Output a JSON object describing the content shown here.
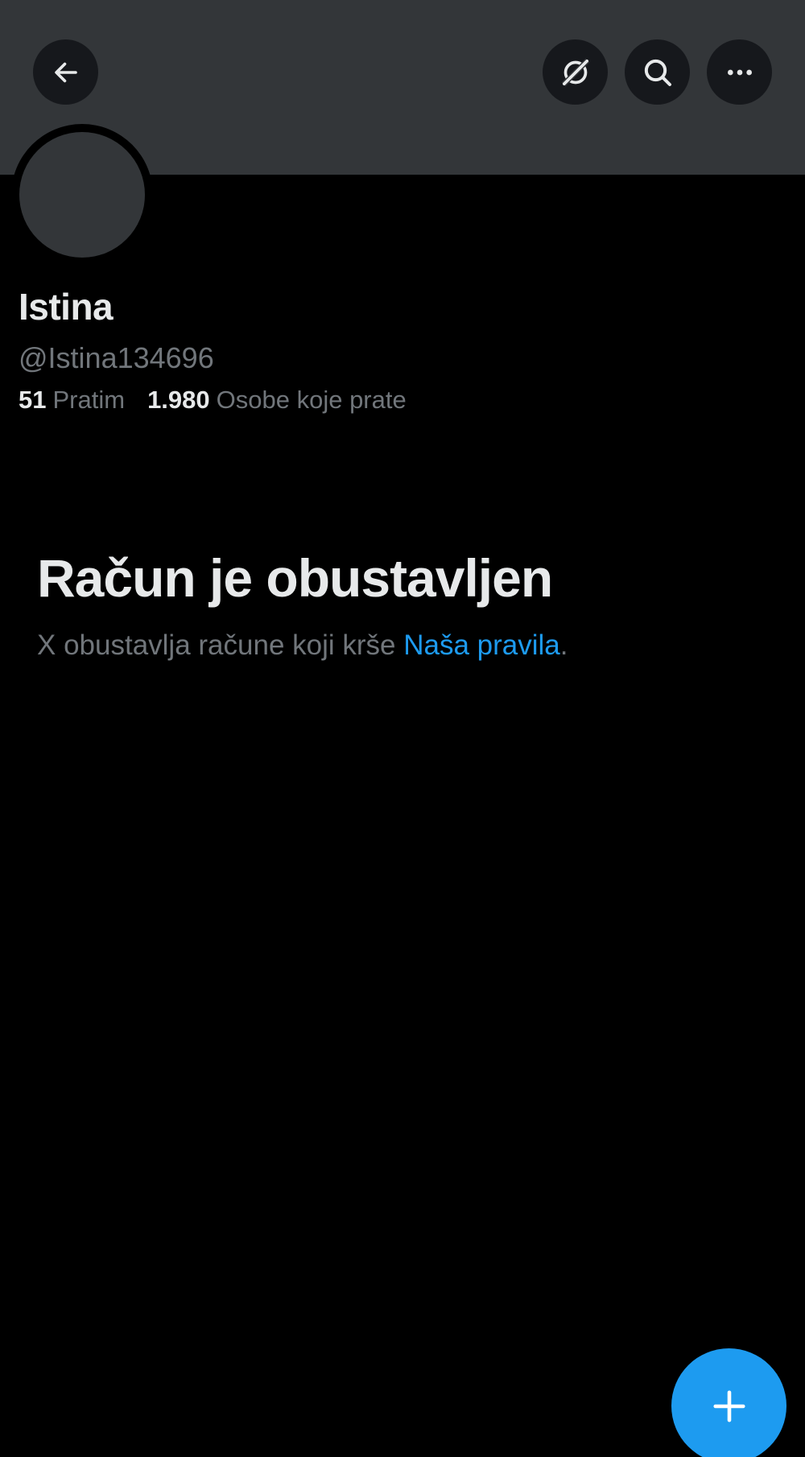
{
  "profile": {
    "display_name": "Istina",
    "handle": "@Istina134696",
    "following_count": "51",
    "following_label": "Pratim",
    "followers_count": "1.980",
    "followers_label": "Osobe koje prate"
  },
  "suspension": {
    "title": "Račun je obustavljen",
    "message": "X obustavlja račune koji krše",
    "link_text": "Naša pravila",
    "trailing": "."
  },
  "icons": {
    "back": "arrow-left-icon",
    "grok": "grok-icon",
    "search": "search-icon",
    "more": "more-dots-icon",
    "compose": "plus-icon"
  },
  "colors": {
    "background": "#000000",
    "banner": "#333639",
    "accent": "#1d9bf0",
    "primary_text": "#e7e9ea",
    "secondary_text": "#71767b"
  }
}
